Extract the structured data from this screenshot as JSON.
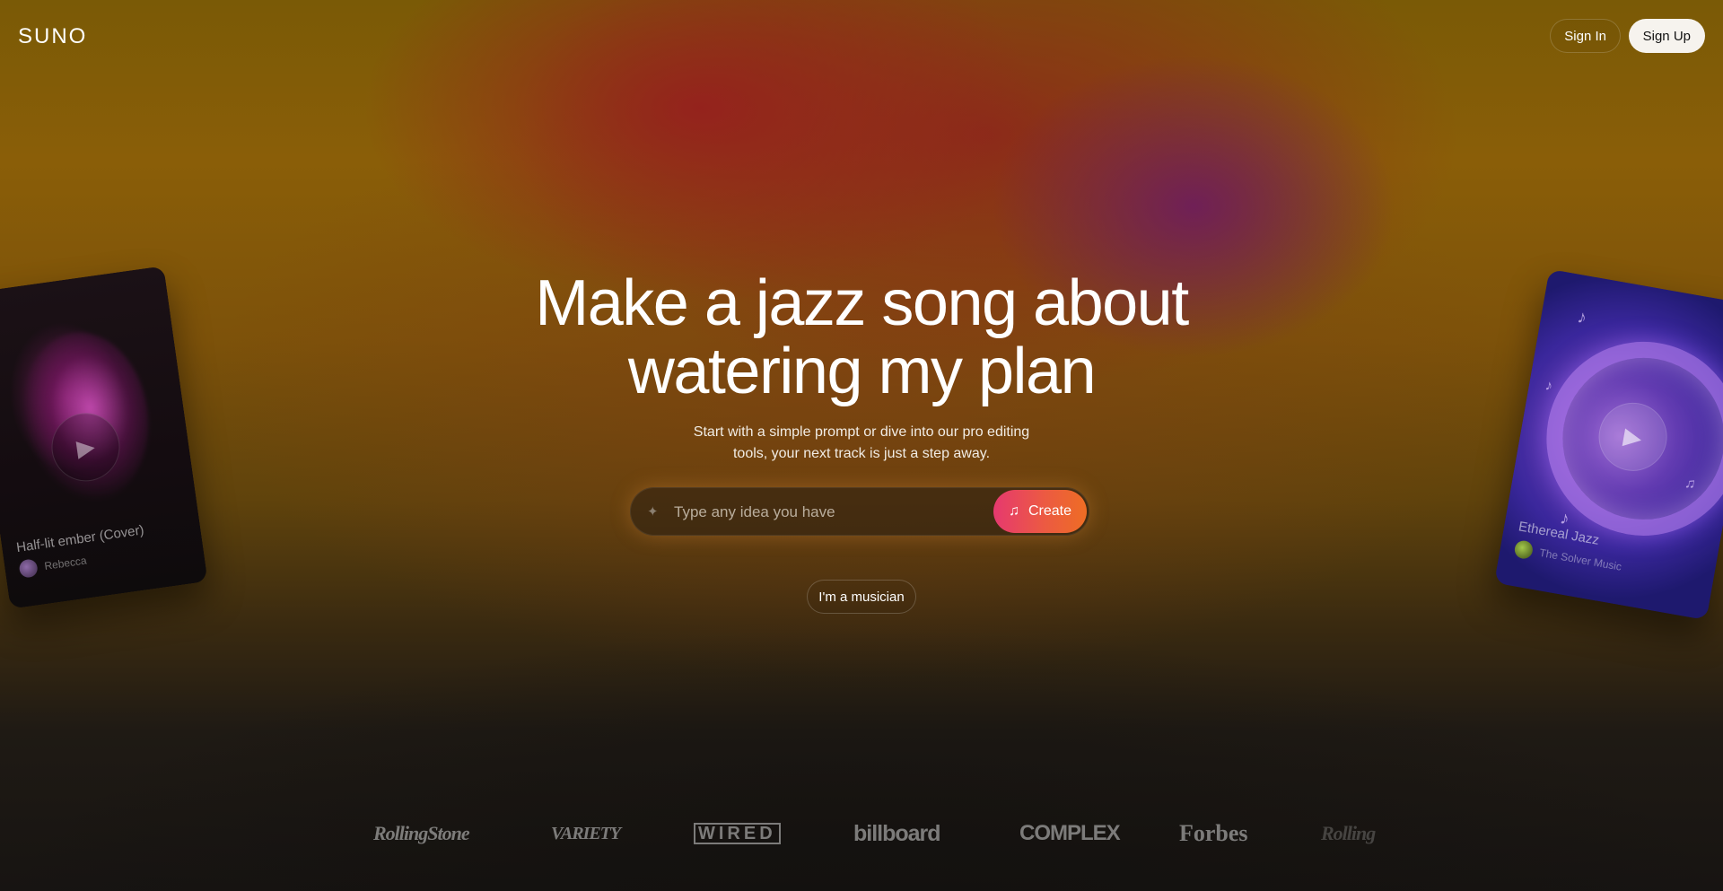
{
  "header": {
    "logo": "SUNO",
    "sign_in": "Sign In",
    "sign_up": "Sign Up"
  },
  "hero": {
    "headline_line1": "Make a jazz song about",
    "headline_line2": "watering my plan",
    "subtitle": "Start with a simple prompt or dive into our pro editing tools, your next track is just a step away."
  },
  "prompt": {
    "placeholder": "Type any idea you have",
    "value": "",
    "create_label": "Create",
    "sparkle_icon": "sparkle-icon",
    "create_icon": "music-note-icon"
  },
  "musician_button": "I'm a musician",
  "cards": {
    "left": {
      "title": "Half-lit ember (Cover)",
      "artist": "Rebecca"
    },
    "right": {
      "title": "Ethereal Jazz",
      "artist": "The Solver Music"
    }
  },
  "press": {
    "logos": [
      "RollingStone",
      "VARIETY",
      "WIRED",
      "billboard",
      "COMPLEX",
      "Forbes",
      "Rolling"
    ]
  },
  "colors": {
    "accent_gradient_start": "#e6396f",
    "accent_gradient_end": "#ee6d24",
    "sign_up_bg": "#f6f3ee"
  }
}
